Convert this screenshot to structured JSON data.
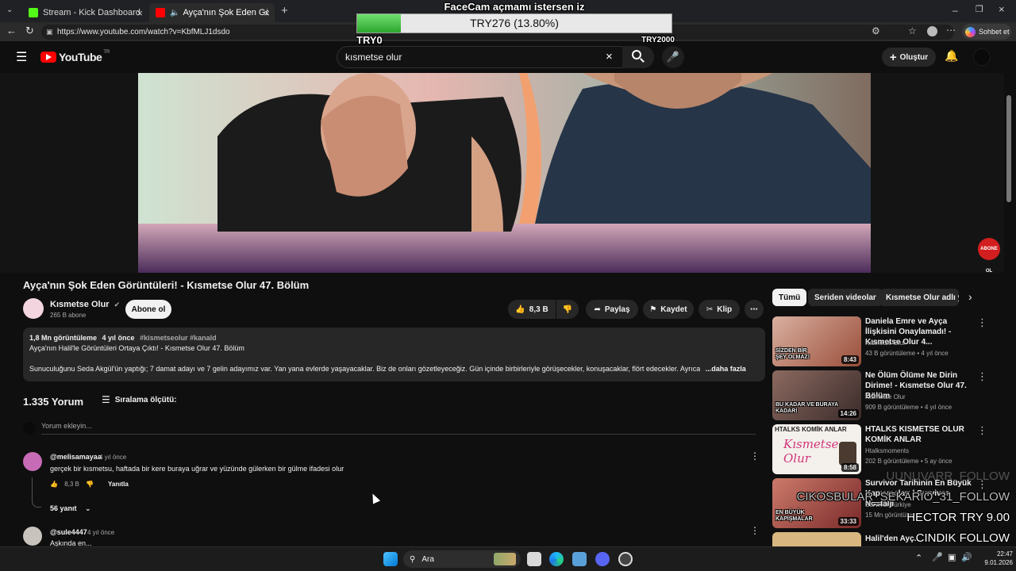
{
  "browser": {
    "tabs": [
      {
        "title": "Stream - Kick Dashboard",
        "favicon_color": "#53fc18"
      },
      {
        "title": "Ayça'nın Şok Eden Görüntüle",
        "favicon_color": "#ff0000"
      }
    ],
    "url": "https://www.youtube.com/watch?v=KbfMLJ1dsdo",
    "copilot_label": "Sohbet et",
    "new_tab": "+"
  },
  "overlay": {
    "facecam_title": "FaceCam açmamı istersen iz",
    "facecam_title_exact": "FaceCam açmamı istersen iz",
    "facecam_amount": "TRY276 (13.80%)",
    "facecam_min": "TRY0",
    "facecam_max": "TRY2000",
    "facecam_progress": 0.138,
    "follow_lines": [
      "UUNUVARR_FOLLOW",
      "CIKOSBULAR_SEKARIO_31_FOLLOW",
      "HECTOR  TRY 9.00",
      "CINDIK  FOLLOW"
    ],
    "subscribe_badge": "ABONE OL"
  },
  "youtube": {
    "logo_text": "YouTube",
    "logo_region": "TR",
    "search_query": "kısmetse olur",
    "create_label": "Oluştur",
    "video": {
      "title": "Ayça'nın Şok Eden Görüntüleri! - Kısmetse Olur 47. Bölüm",
      "channel": "Kısmetse Olur",
      "subscribers": "265 B abone",
      "subscribe_label": "Abone ol",
      "likes": "8,3 B",
      "share_label": "Paylaş",
      "save_label": "Kaydet",
      "clip_label": "Klip",
      "views": "1,8 Mn görüntüleme",
      "age": "4 yıl önce",
      "hashtags": "#kismetseolur #kanald",
      "desc_line1": "Ayça'nın Halil'le Görüntüleri Ortaya Çıktı! - Kısmetse Olur 47. Bölüm",
      "desc_line2": "Sunuculuğunu Seda Akgül'ün yaptığı; 7 damat adayı ve 7 gelin adayımız var. Yan yana evlerde yaşayacaklar. Biz de onları gözetleyeceğiz. Gün içinde birbirleriyle görüşecekler, konuşacaklar, flört edecekler. Ayrıca",
      "more_label": "...daha fazla"
    },
    "comments": {
      "count_label": "1.335 Yorum",
      "sort_label": "Sıralama ölçütü:",
      "add_placeholder": "Yorum ekleyin...",
      "items": [
        {
          "author": "@melisamayaa",
          "age": "4 yıl önce",
          "text": "gerçek bir kısmetsu, haftada bir kere buraya uğrar ve yüzünde gülerken bir gülme ifadesi olur",
          "likes": "8,3 B",
          "reply_label": "Yanıtla",
          "replies": "56 yanıt"
        },
        {
          "author": "@sule4447",
          "age": "4 yıl önce",
          "text": "Aşkında en..."
        }
      ]
    },
    "chips": [
      "Tümü",
      "Seriden videolar",
      "Kısmetse Olur adlı yü"
    ],
    "recommendations": [
      {
        "title": "Daniela Emre ve Ayça İlişkisini Onaylamadı! - Kısmetse Olur 4...",
        "channel": "Kısmetse Olur",
        "meta": "43 B görüntüleme • 4 yıl önce",
        "duration": "8:43",
        "thumb_text": "SİZDEN BİR ŞEY OLMAZ!",
        "thumb_color": "#a86a4a"
      },
      {
        "title": "Ne Ölüm Ölüme Ne Dirin Dirime! - Kısmetse Olur 47. Bölüm",
        "channel": "Kısmetse Olur",
        "meta": "909 B görüntüleme • 4 yıl önce",
        "duration": "14:26",
        "thumb_text": "BU KADAR VE BURAYA KADAR!",
        "thumb_color": "#6a4a48"
      },
      {
        "title": "HTALKS KISMETSE OLUR KOMİK ANLAR",
        "channel": "Htalksmoments",
        "meta": "202 B görüntüleme • 5 ay önce",
        "duration": "8:58",
        "thumb_text": "HTALKS KOMİK ANLAR",
        "thumb_color": "#f4f0ec"
      },
      {
        "title": "Survivor Tarihinin En Büyük Kapışmaları | Survivor Nostalji",
        "channel": "Survivor Türkiye",
        "meta": "15 Mn görüntüleme",
        "duration": "33:33",
        "thumb_text": "EN BÜYÜK KAPIŞMALAR",
        "thumb_color": "#b04040"
      },
      {
        "title": "Halil'den Ayç...",
        "channel": "",
        "meta": "",
        "duration": "",
        "thumb_text": "",
        "thumb_color": "#d8b880"
      }
    ]
  },
  "taskbar": {
    "search_label": "Ara",
    "time": "22:47",
    "date": "9.01.2026"
  }
}
